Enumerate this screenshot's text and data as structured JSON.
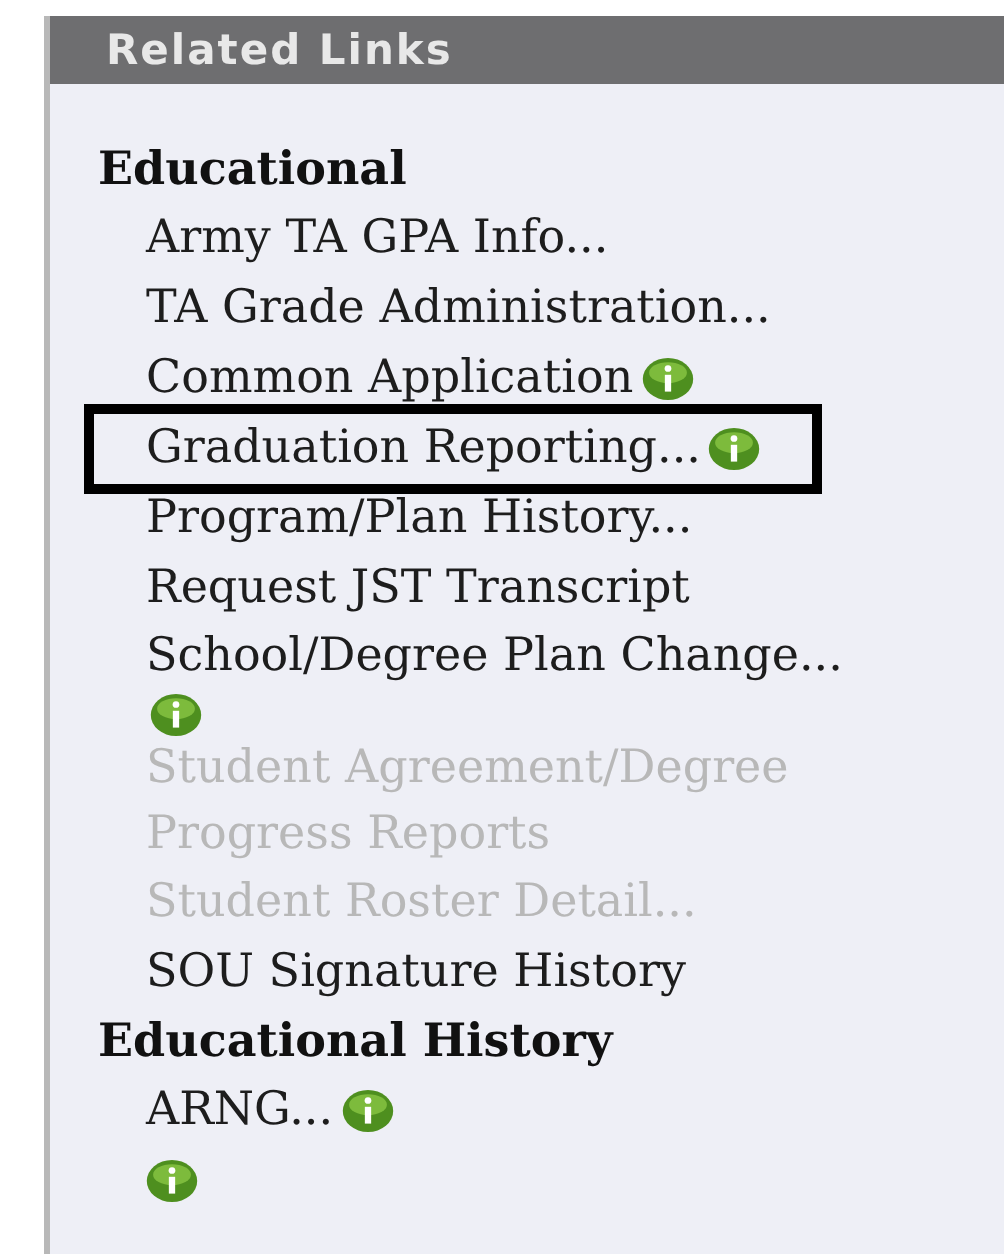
{
  "panel": {
    "title": "Related Links"
  },
  "sections": [
    {
      "heading": "Educational",
      "items": [
        {
          "label": "Army TA GPA Info...",
          "disabled": false,
          "info": false,
          "highlighted": false
        },
        {
          "label": "TA Grade Administration...",
          "disabled": false,
          "info": false,
          "highlighted": false
        },
        {
          "label": "Common Application",
          "disabled": false,
          "info": true,
          "highlighted": false
        },
        {
          "label": "Graduation Reporting...",
          "disabled": false,
          "info": true,
          "highlighted": true
        },
        {
          "label": "Program/Plan History...",
          "disabled": false,
          "info": false,
          "highlighted": false
        },
        {
          "label": "Request JST Transcript",
          "disabled": false,
          "info": false,
          "highlighted": false
        },
        {
          "label": "School/Degree Plan Change...",
          "disabled": false,
          "info": true,
          "highlighted": false,
          "info_wrapped": true
        },
        {
          "label": "Student Agreement/Degree Progress Reports",
          "disabled": true,
          "info": false,
          "highlighted": false
        },
        {
          "label": "Student Roster Detail...",
          "disabled": true,
          "info": false,
          "highlighted": false
        },
        {
          "label": "SOU Signature History",
          "disabled": false,
          "info": false,
          "highlighted": false
        }
      ]
    },
    {
      "heading": "Educational History",
      "items": [
        {
          "label": "ARNG...",
          "disabled": false,
          "info": true,
          "highlighted": false
        },
        {
          "info": true
        }
      ]
    }
  ]
}
